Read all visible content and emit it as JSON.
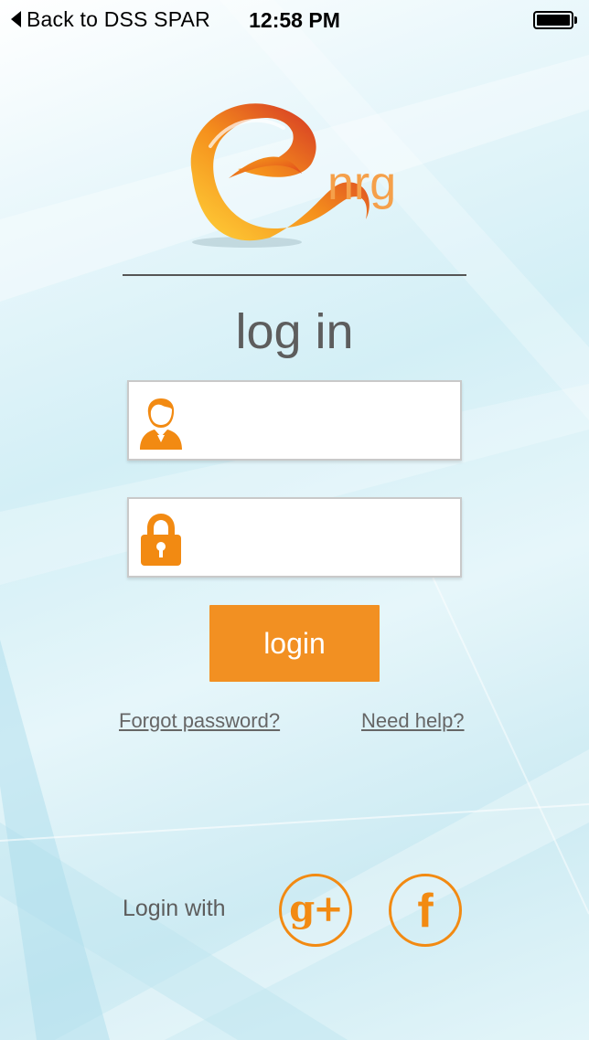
{
  "status_bar": {
    "back_label": "Back to DSS SPAR",
    "time": "12:58 PM",
    "battery_level": 1.0
  },
  "logo": {
    "text": "nrg"
  },
  "heading": "log in",
  "username_field": {
    "value": "",
    "icon": "user-icon"
  },
  "password_field": {
    "value": "",
    "icon": "lock-icon"
  },
  "login_button_label": "login",
  "links": {
    "forgot_password": "Forgot password?",
    "need_help": "Need help?"
  },
  "social": {
    "label": "Login with",
    "google_glyph": "g+",
    "facebook_glyph": "f"
  },
  "colors": {
    "accent": "#f29022",
    "heading_text": "#5d5d5d",
    "background": "#d3eff6"
  }
}
